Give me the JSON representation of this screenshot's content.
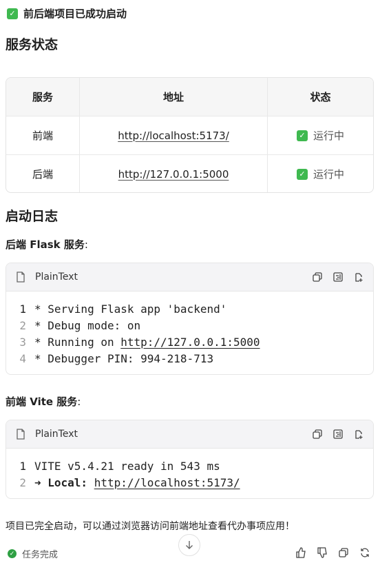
{
  "header": {
    "status_line": "前后端项目已成功启动"
  },
  "service_status": {
    "title": "服务状态",
    "columns": [
      "服务",
      "地址",
      "状态"
    ],
    "rows": [
      {
        "service": "前端",
        "address": "http://localhost:5173/",
        "status": "运行中"
      },
      {
        "service": "后端",
        "address": "http://127.0.0.1:5000",
        "status": "运行中"
      }
    ]
  },
  "logs": {
    "title": "启动日志",
    "backend": {
      "heading": "后端 Flask 服务",
      "colon": ":",
      "language": "PlainText",
      "lines": [
        {
          "num": "1",
          "text": "* Serving Flask app 'backend'",
          "link": ""
        },
        {
          "num": "2",
          "text": "* Debug mode: on",
          "link": ""
        },
        {
          "num": "3",
          "text": "* Running on ",
          "link": "http://127.0.0.1:5000"
        },
        {
          "num": "4",
          "text": "* Debugger PIN: 994-218-713",
          "link": ""
        }
      ]
    },
    "frontend": {
      "heading": "前端 Vite 服务",
      "colon": ":",
      "language": "PlainText",
      "lines": [
        {
          "num": "1",
          "text": "VITE v5.4.21 ready in 543 ms",
          "link": ""
        },
        {
          "num": "2",
          "text": "➜ Local: ",
          "link": "http://localhost:5173/"
        }
      ]
    }
  },
  "footer": {
    "message": "项目已完全启动，可以通过浏览器访问前端地址查看代办事项应用！",
    "task_status": "任务完成"
  },
  "icons": {
    "check": "check-square-icon",
    "file": "file-icon",
    "copy": "copy-icon",
    "wrap": "wrap-icon",
    "export": "export-icon",
    "scroll": "arrow-down-icon",
    "like": "thumbs-up-icon",
    "dislike": "thumbs-down-icon",
    "copy_reply": "copy-icon",
    "regenerate": "refresh-icon"
  },
  "colors": {
    "success": "#3fb950",
    "task_done": "#2ea043"
  }
}
